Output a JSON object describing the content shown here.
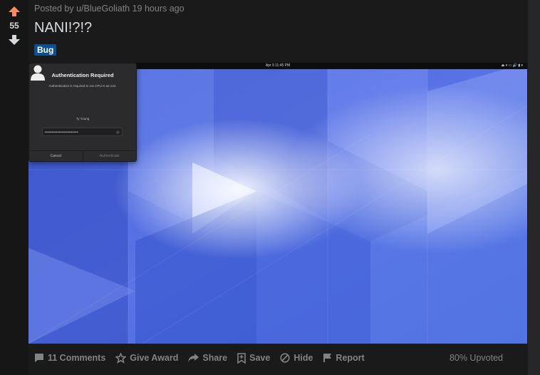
{
  "post": {
    "score": "55",
    "meta": "Posted by u/BlueGoliath 19 hours ago",
    "title": "NANI!?!?",
    "flair": "Bug",
    "upvote_ratio": "80% Upvoted"
  },
  "colors": {
    "upvote": "#ff8b60",
    "downvote": "#d7dadc",
    "flair_bg": "#0e4f8f",
    "page_bg": "#1a1a1b"
  },
  "screenshot": {
    "topbar": {
      "clock": "Apr 9  11:45 PM",
      "tray": "⏏ ▾   ▭ 🔊 ▮ ▾"
    },
    "dialog": {
      "title": "Authentication Required",
      "message": "Authentication is required to run CPU-X as root.",
      "user": "Ty Young",
      "password_mask": "••••••••••••••••••••••••",
      "cancel": "Cancel",
      "authenticate": "Authenticate"
    }
  },
  "actions": [
    {
      "icon": "comment-icon",
      "label": "11 Comments"
    },
    {
      "icon": "award-icon",
      "label": "Give Award"
    },
    {
      "icon": "share-icon",
      "label": "Share"
    },
    {
      "icon": "save-icon",
      "label": "Save"
    },
    {
      "icon": "hide-icon",
      "label": "Hide"
    },
    {
      "icon": "report-icon",
      "label": "Report"
    }
  ]
}
